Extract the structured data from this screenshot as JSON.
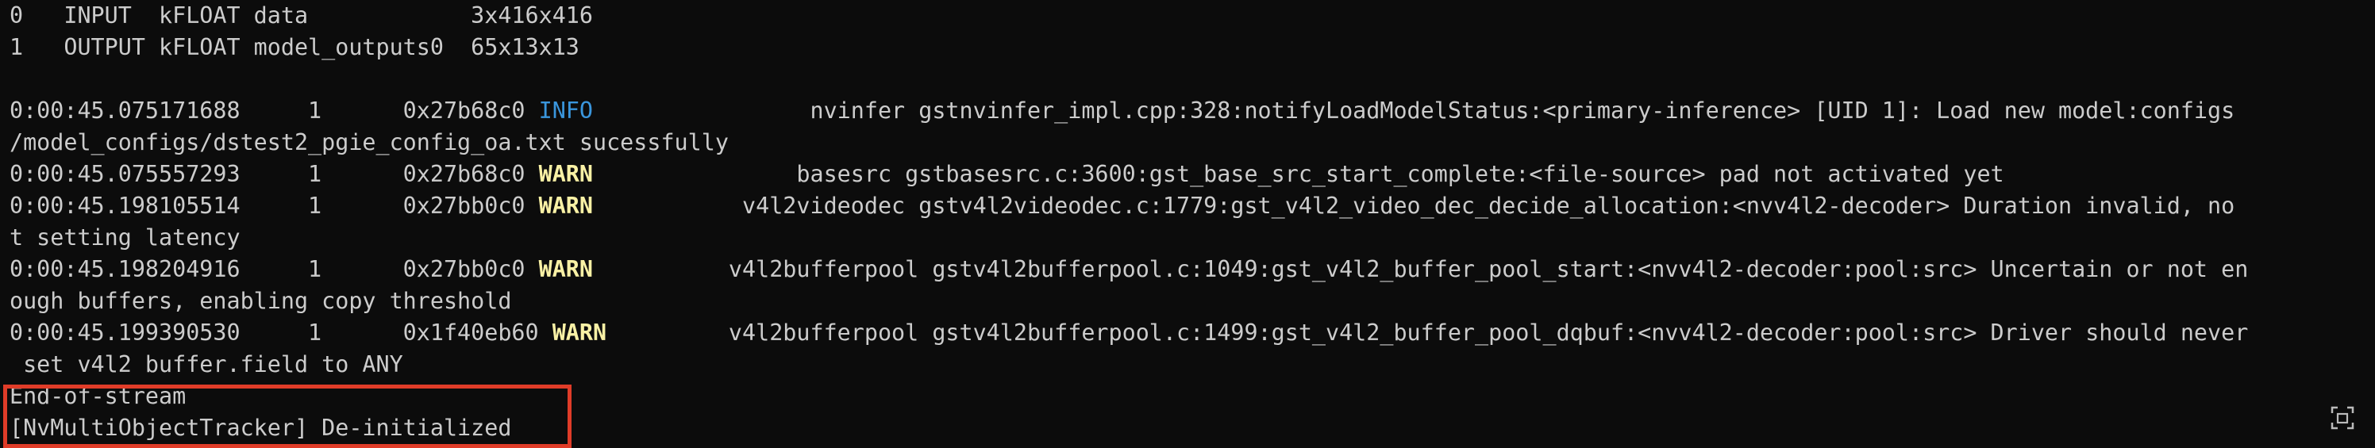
{
  "terminal": {
    "lines": [
      "0   INPUT  kFLOAT data            3x416x416",
      "1   OUTPUT kFLOAT model_outputs0  65x13x13",
      "",
      "0:00:45.075171688     1      0x27b68c0 ",
      "/model_configs/dstest2_pgie_config_oa.txt sucessfully",
      "0:00:45.075557293     1      0x27b68c0 ",
      "0:00:45.198105514     1      0x27bb0c0 ",
      "t setting latency",
      "0:00:45.198204916     1      0x27bb0c0 ",
      "ough buffers, enabling copy threshold",
      "0:00:45.199390530     1      0x1f40eb60 ",
      " set v4l2 buffer.field to ANY",
      "End-of-stream",
      "[NvMultiObjectTracker] De-initialized"
    ],
    "levels": {
      "l3": "INFO",
      "l5": "WARN",
      "l6": "WARN",
      "l8": "WARN",
      "l10": "WARN"
    },
    "tails": {
      "l3": "                nvinfer gstnvinfer_impl.cpp:328:notifyLoadModelStatus:<primary-inference> [UID 1]: Load new model:configs",
      "l5": "               basesrc gstbasesrc.c:3600:gst_base_src_start_complete:<file-source> pad not activated yet",
      "l6": "           v4l2videodec gstv4l2videodec.c:1779:gst_v4l2_video_dec_decide_allocation:<nvv4l2-decoder> Duration invalid, no",
      "l8": "          v4l2bufferpool gstv4l2bufferpool.c:1049:gst_v4l2_buffer_pool_start:<nvv4l2-decoder:pool:src> Uncertain or not en",
      "l10": "         v4l2bufferpool gstv4l2bufferpool.c:1499:gst_v4l2_buffer_pool_dqbuf:<nvv4l2-decoder:pool:src> Driver should never"
    }
  },
  "colors": {
    "background": "#0c0c0c",
    "text": "#cccccc",
    "info": "#3a96dd",
    "warn": "#f9f1a5",
    "highlight_border": "#e03c28"
  },
  "icons": {
    "corner": "copy-region-icon"
  }
}
